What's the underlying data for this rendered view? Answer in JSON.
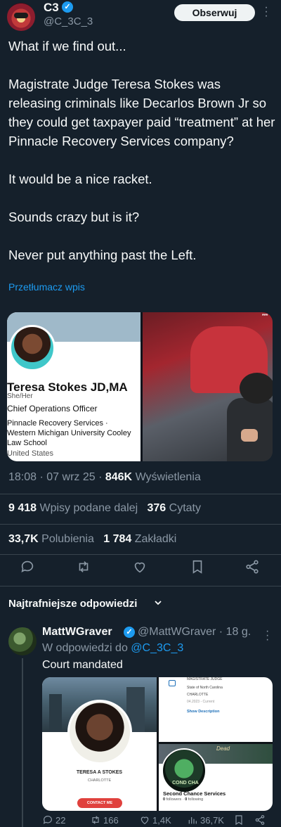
{
  "author": {
    "name": "C3",
    "handle": "@C_3C_3",
    "follow_label": "Obserwuj"
  },
  "tweet": {
    "lines": [
      "What if we find out...",
      "Magistrate Judge Teresa Stokes was releasing criminals like Decarlos Brown Jr so they could get taxpayer paid “treatment” at her Pinnacle Recovery Services company?",
      "It would be a nice racket.",
      "Sounds crazy but is it?",
      "Never put anything past the Left."
    ],
    "translate": "Przetłumacz wpis"
  },
  "media": {
    "profile": {
      "name": "Teresa Stokes JD,MA",
      "pronouns": "She/Her",
      "role": "Chief Operations Officer",
      "org1": "Pinnacle Recovery Services ·",
      "org2": "Western Michigan University Cooley",
      "org3": "Law School",
      "location": "United States"
    },
    "badge": "***"
  },
  "meta": {
    "time": "18:08",
    "date": "07 wrz 25",
    "views": "846K",
    "views_label": "Wyświetlenia"
  },
  "stats": {
    "reposts": "9 418",
    "reposts_label": "Wpisy podane dalej",
    "quotes": "376",
    "quotes_label": "Cytaty",
    "likes": "33,7K",
    "likes_label": "Polubienia",
    "bookmarks": "1 784",
    "bookmarks_label": "Zakładki"
  },
  "best_replies_label": "Najtrafniejsze odpowiedzi",
  "reply": {
    "name": "MattWGraver",
    "handle": "@MattWGraver · 18 g.",
    "reply_to_prefix": "W odpowiedzi do",
    "reply_to_handle": "@C_3C_3",
    "text": "Court mandated",
    "media": {
      "name": "TERESA A STOKES",
      "location": "CHARLOTTE",
      "contact": "CONTACT ME",
      "doc_title": "MAGISTRATE JUDGE",
      "doc_state": "State of North Carolina",
      "doc_city": "CHARLOTTE",
      "doc_dates": "04.2023 - Current",
      "doc_link": "Show Description",
      "banner_text": "Dead",
      "logo_text": "COND CHA",
      "org_name": "Second Chance Services",
      "followers": "0",
      "followers_label": "followers",
      "following": "0",
      "following_label": "following"
    },
    "actions": {
      "replies": "22",
      "reposts": "166",
      "likes": "1,4K",
      "views": "36,7K"
    }
  },
  "colors": {
    "background": "#15202b",
    "accent": "#1d9bf0",
    "muted": "#8b98a5",
    "divider": "#38444d"
  }
}
